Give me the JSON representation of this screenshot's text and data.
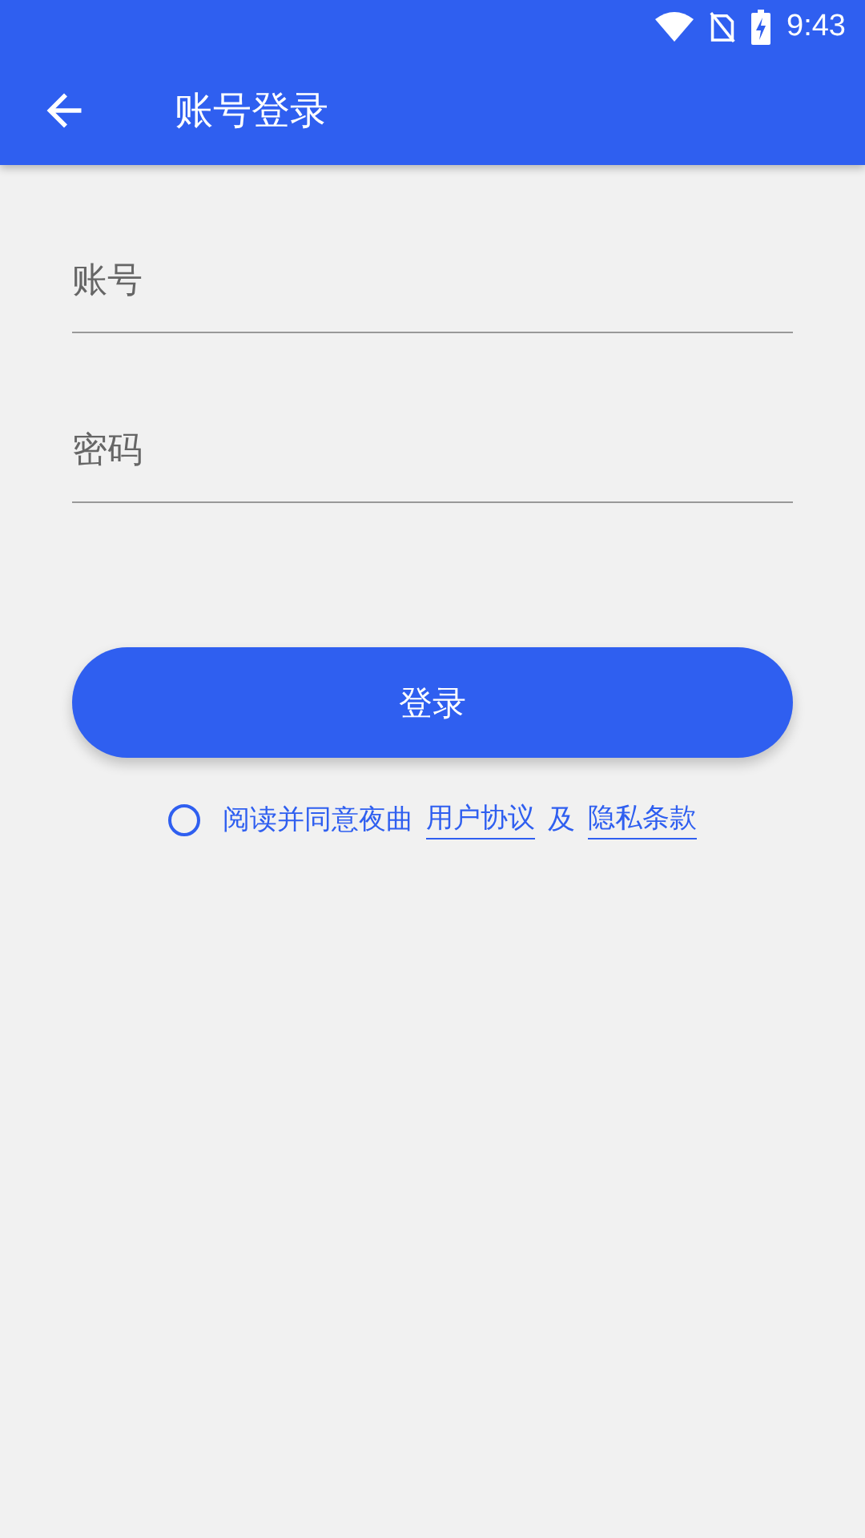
{
  "status_bar": {
    "time": "9:43"
  },
  "app_bar": {
    "title": "账号登录"
  },
  "fields": [
    {
      "placeholder": "账号"
    },
    {
      "placeholder": "密码"
    }
  ],
  "login_button": "登录",
  "agreement": {
    "checked": false,
    "prefix": "阅读并同意夜曲",
    "first_link": "用户协议",
    "joiner": "及",
    "second_link": "隐私条款"
  }
}
